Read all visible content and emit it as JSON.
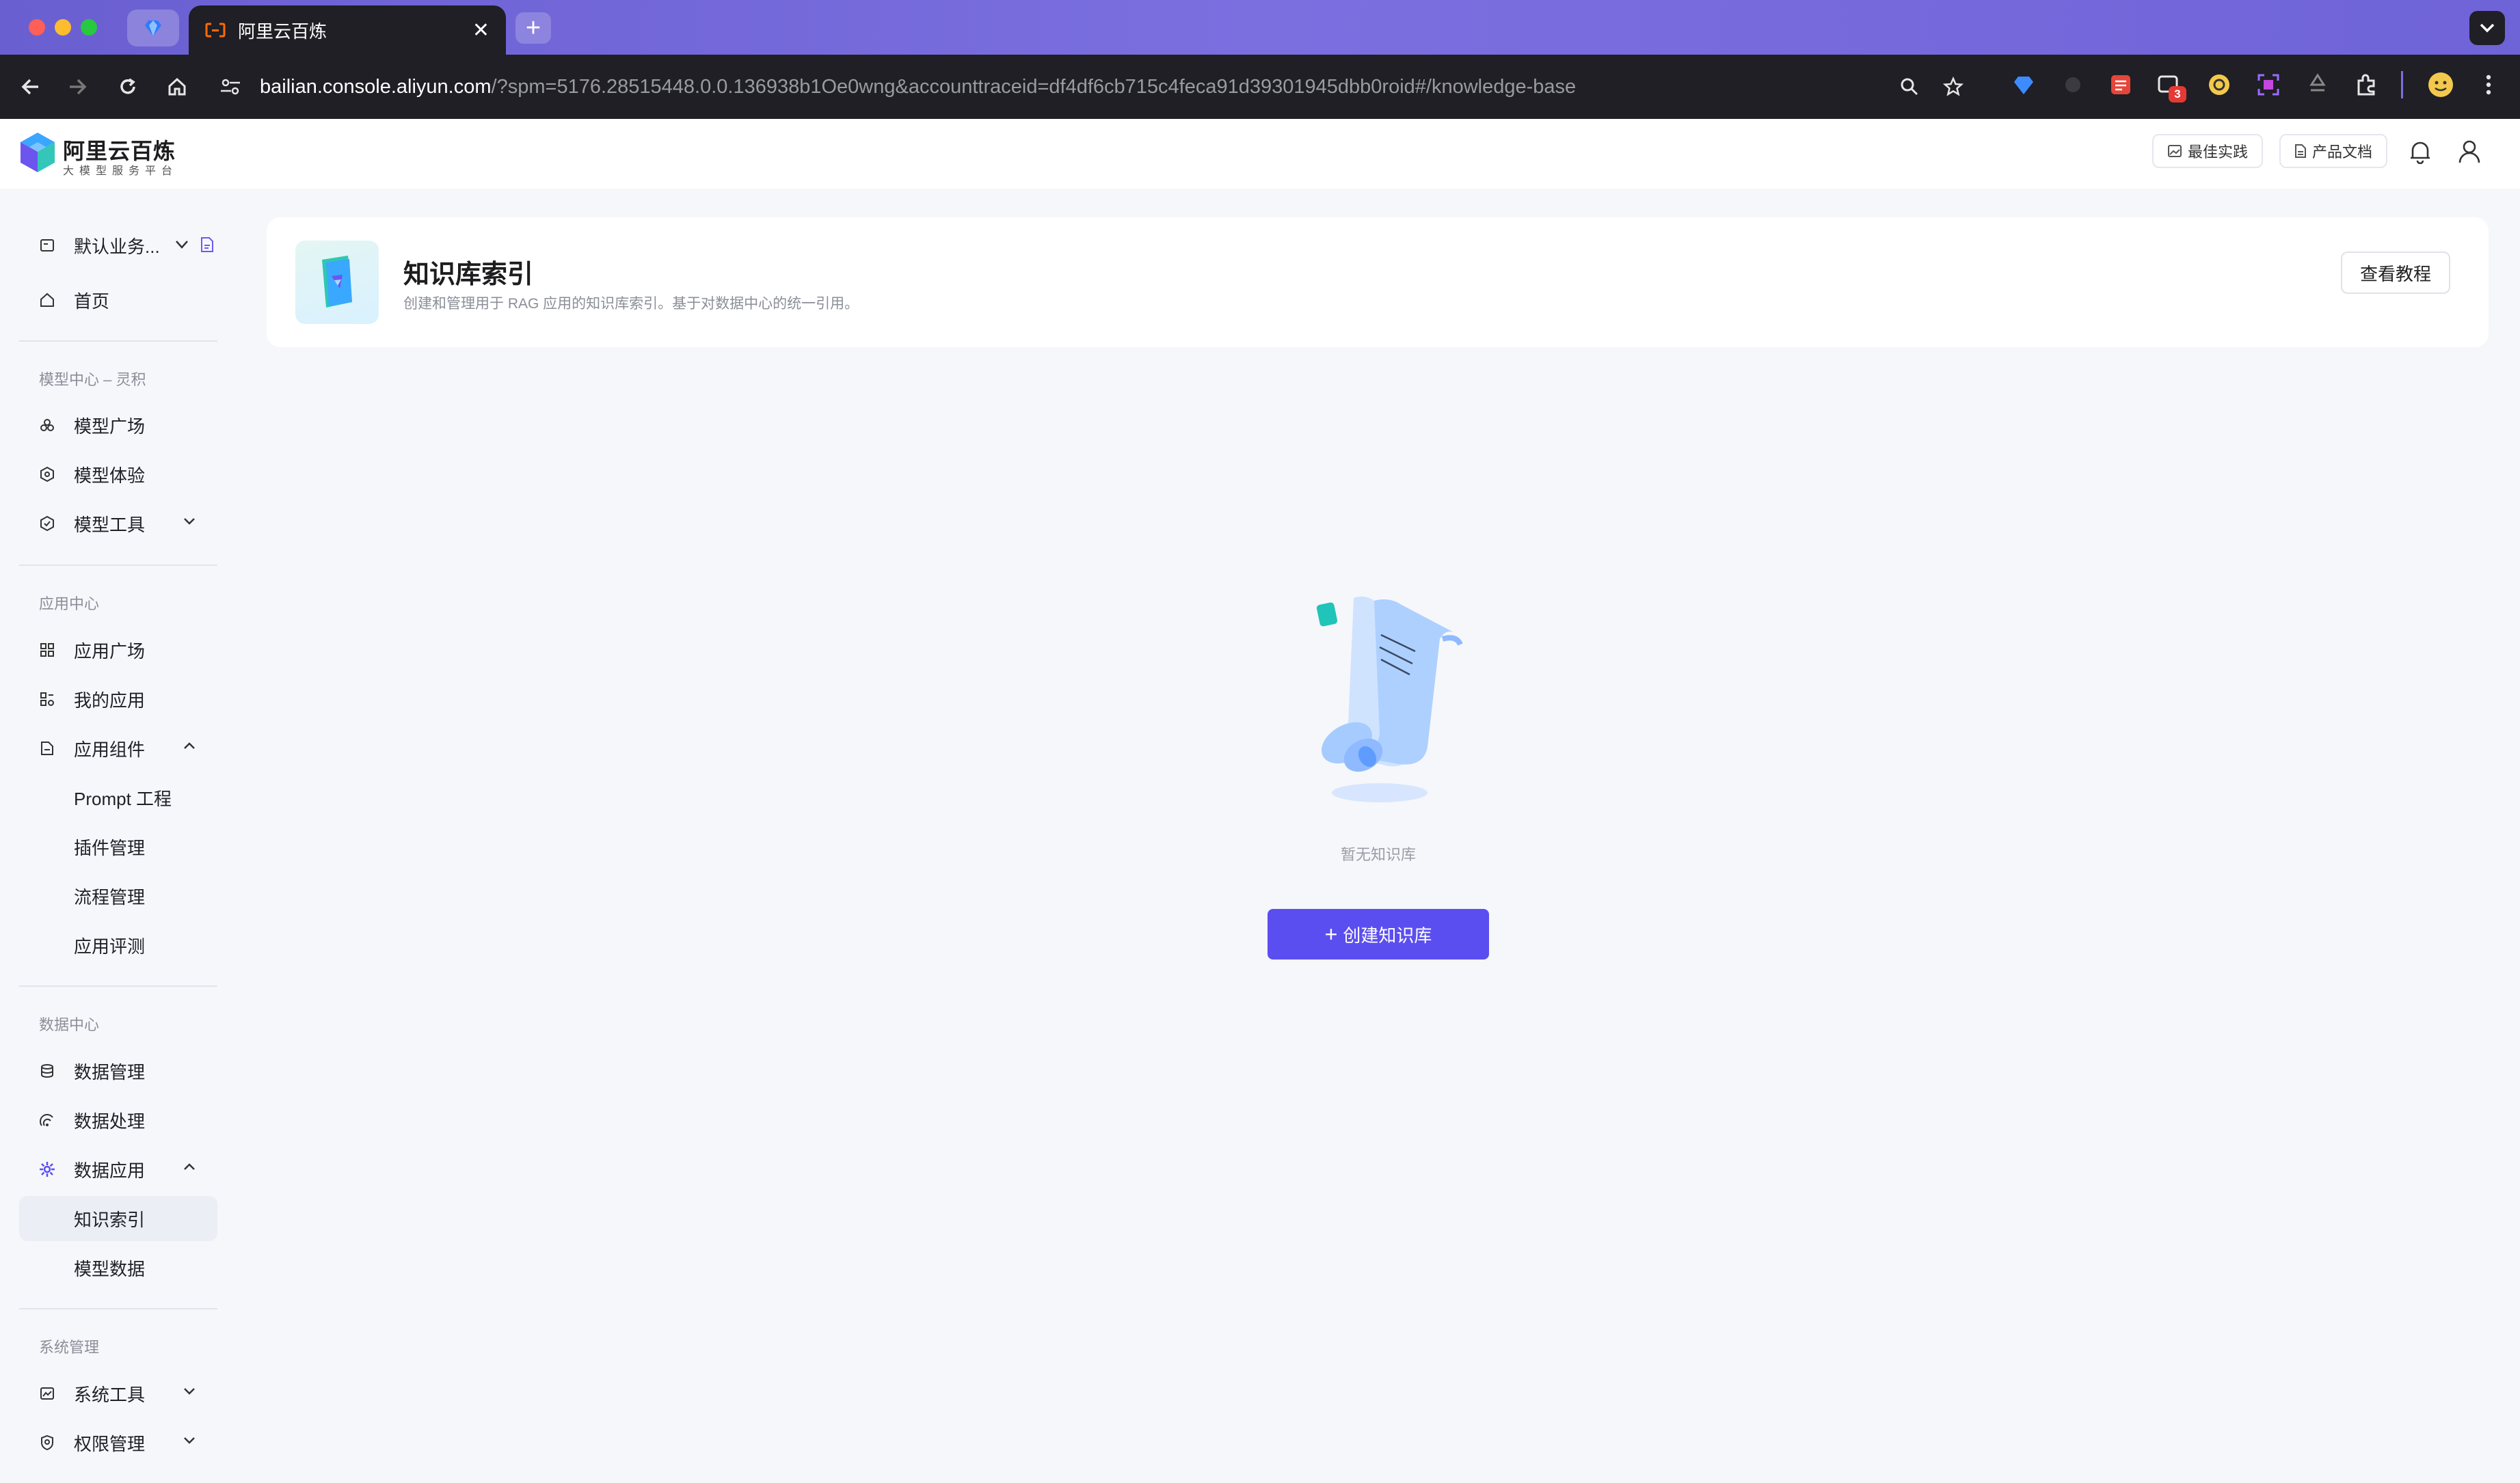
{
  "browser": {
    "tab_title": "阿里云百炼",
    "url_host": "bailian.console.aliyun.com",
    "url_rest": "/?spm=5176.28515448.0.0.136938b1Oe0wng&accounttraceid=df4df6cb715c4feca91d39301945dbb0roid#/knowledge-base",
    "new_tab_label": "+",
    "close_label": "✕",
    "ext_badge": "3"
  },
  "header": {
    "logo_title": "阿里云百炼",
    "logo_subtitle": "大模型服务平台",
    "best_practice": "最佳实践",
    "product_docs": "产品文档"
  },
  "sidebar": {
    "workspace": "默认业务...",
    "home": "首页",
    "section_model": "模型中心 – 灵积",
    "model_square": "模型广场",
    "model_experience": "模型体验",
    "model_tools": "模型工具",
    "section_app": "应用中心",
    "app_square": "应用广场",
    "my_apps": "我的应用",
    "app_components": "应用组件",
    "prompt_engineering": "Prompt 工程",
    "plugin_management": "插件管理",
    "flow_management": "流程管理",
    "app_evaluation": "应用评测",
    "section_data": "数据中心",
    "data_management": "数据管理",
    "data_processing": "数据处理",
    "data_application": "数据应用",
    "knowledge_index": "知识索引",
    "model_data": "模型数据",
    "section_system": "系统管理",
    "system_tools": "系统工具",
    "permission_management": "权限管理"
  },
  "main": {
    "title": "知识库索引",
    "description": "创建和管理用于 RAG 应用的知识库索引。基于对数据中心的统一引用。",
    "tutorial_button": "查看教程",
    "empty_text": "暂无知识库",
    "create_button": "创建知识库",
    "create_plus": "+"
  },
  "colors": {
    "accent": "#5b4ef0",
    "tabbar": "#6a5fd1",
    "toolbar": "#1f1f25"
  }
}
